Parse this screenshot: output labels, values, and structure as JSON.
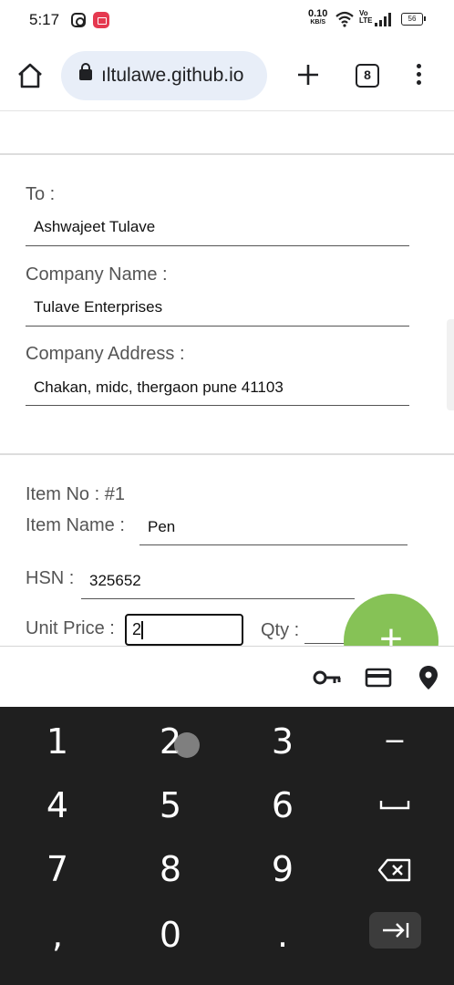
{
  "status_bar": {
    "time": "5:17",
    "net_speed_value": "0.10",
    "net_speed_unit": "KB/S",
    "volte_line1": "Vo",
    "volte_line2": "LTE",
    "battery": "56"
  },
  "browser": {
    "url": "ıltulawe.github.io",
    "tab_count": "8"
  },
  "form": {
    "to_label": "To :",
    "to_value": "Ashwajeet Tulave",
    "company_name_label": "Company Name :",
    "company_name_value": "Tulave Enterprises",
    "company_address_label": "Company Address :",
    "company_address_value": "Chakan, midc, thergaon pune 41103"
  },
  "item": {
    "item_no_label": "Item No : #1",
    "item_name_label": "Item Name :",
    "item_name_value": "Pen",
    "hsn_label": "HSN :",
    "hsn_value": "325652",
    "unit_price_label": "Unit Price :",
    "unit_price_value": "2",
    "qty_label": "Qty :",
    "add_button": "+"
  },
  "keyboard": {
    "row1": [
      "1",
      "2",
      "3",
      "−"
    ],
    "row2": [
      "4",
      "5",
      "6"
    ],
    "row3": [
      "7",
      "8",
      "9"
    ],
    "row4": [
      ",",
      "0",
      "."
    ]
  },
  "colors": {
    "fab": "#86c256",
    "keyboard_bg": "#1f1f1f",
    "url_bar": "#e8eef8",
    "record_badge": "#e53950"
  }
}
